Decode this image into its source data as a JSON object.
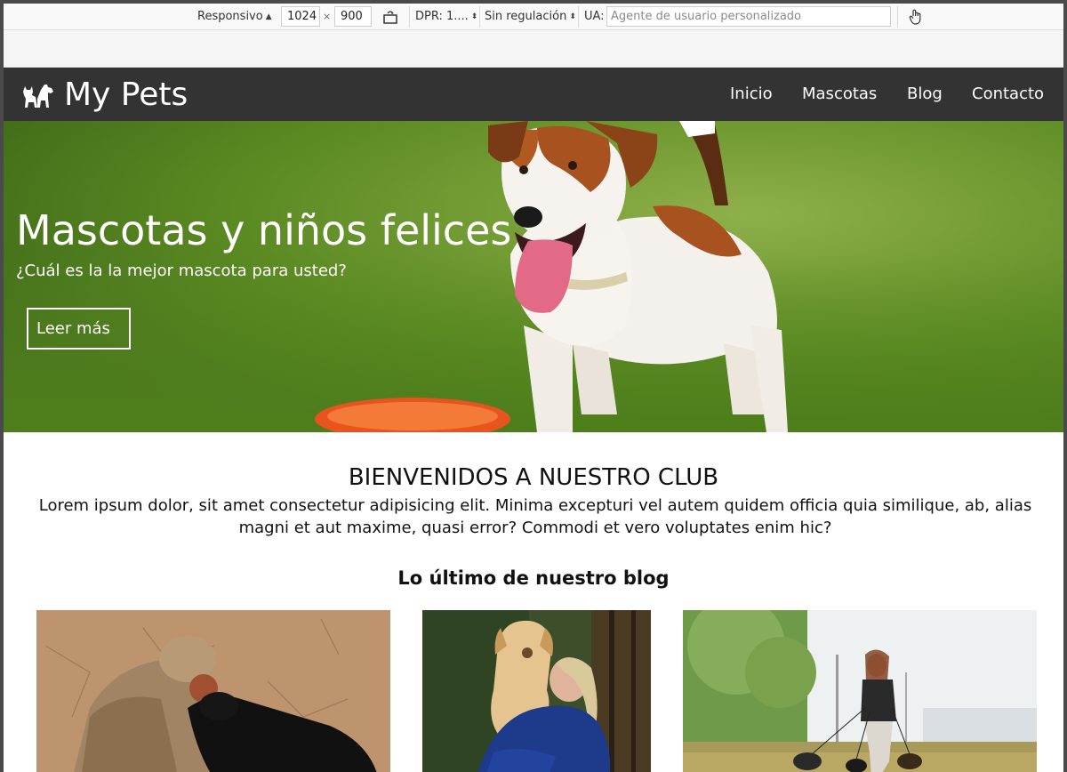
{
  "toolbar": {
    "device": "Responsivo",
    "width": "1024",
    "times": "×",
    "height": "900",
    "dpr": "DPR: 1....",
    "throttling": "Sin regulación",
    "ua_label": "UA:",
    "ua_placeholder": "Agente de usuario personalizado"
  },
  "navbar": {
    "brand": "My Pets",
    "items": [
      {
        "label": "Inicio"
      },
      {
        "label": "Mascotas"
      },
      {
        "label": "Blog"
      },
      {
        "label": "Contacto"
      }
    ]
  },
  "hero": {
    "title": "Mascotas y niños felices",
    "subtitle": "¿Cuál es la la mejor mascota para usted?",
    "button": "Leer más"
  },
  "welcome": {
    "title": "BIENVENIDOS A NUESTRO CLUB",
    "text": "Lorem ipsum dolor, sit amet consectetur adipisicing elit. Minima excepturi vel autem quidem officia quia similique, ab, alias magni et aut maxime, quasi error? Commodi et vero voluptates enim hic?"
  },
  "blog": {
    "title": "Lo último de nuestro blog"
  }
}
